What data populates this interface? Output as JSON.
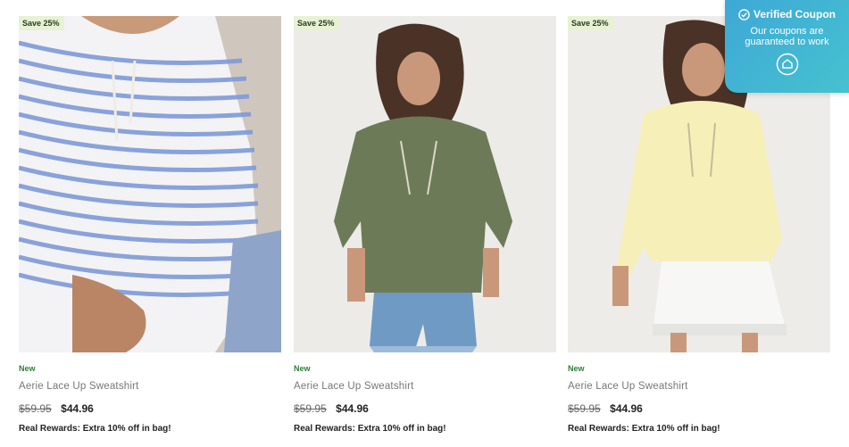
{
  "products": [
    {
      "badge": "Save 25%",
      "tag": "New",
      "name": "Aerie Lace Up Sweatshirt",
      "old_price": "$59.95",
      "price": "$44.96",
      "promo": "Real Rewards: Extra 10% off in bag!"
    },
    {
      "badge": "Save 25%",
      "tag": "New",
      "name": "Aerie Lace Up Sweatshirt",
      "old_price": "$59.95",
      "price": "$44.96",
      "promo": "Real Rewards: Extra 10% off in bag!"
    },
    {
      "badge": "Save 25%",
      "tag": "New",
      "name": "Aerie Lace Up Sweatshirt",
      "old_price": "$59.95",
      "price": "$44.96",
      "promo": "Real Rewards: Extra 10% off in bag!"
    }
  ],
  "coupon": {
    "title": "Verified Coupon",
    "subtitle": "Our coupons are guaranteed to work",
    "icons": [
      "check-circle-icon",
      "shield-icon"
    ]
  },
  "colors": {
    "badge_bg": "#e7f1d4",
    "new_tag": "#2f7d3a",
    "coupon_bg": "#3ea8d6"
  }
}
